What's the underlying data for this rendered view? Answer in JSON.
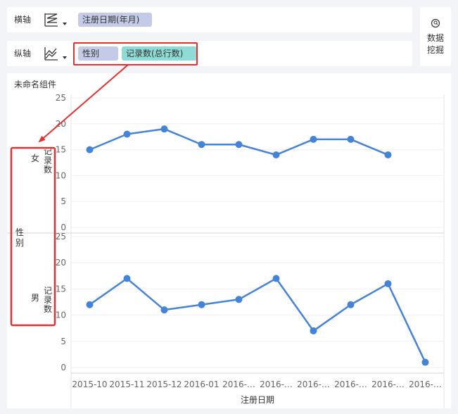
{
  "x_axis": {
    "label": "横轴",
    "fields": [
      "注册日期(年月)"
    ]
  },
  "y_axis": {
    "label": "纵轴",
    "fields": [
      "性别",
      "记录数(总行数)"
    ]
  },
  "mining_button": {
    "label": "数据\n挖掘"
  },
  "widget": {
    "title": "未命名组件"
  },
  "colors": {
    "line": "#4583d8",
    "highlight": "#e53030",
    "pill_blue": "#c4cbe8",
    "pill_teal": "#8fdcd6"
  },
  "chart_data": {
    "type": "line",
    "categories": [
      "2015-10",
      "2015-11",
      "2015-12",
      "2016-01",
      "2016-…",
      "2016-…",
      "2016-…",
      "2016-…",
      "2016-…",
      "2016-…"
    ],
    "xlabel": "注册日期",
    "row_dimension_label": "性别",
    "ylabel": "记录数",
    "ylim": [
      0,
      25
    ],
    "yticks": [
      0,
      5,
      10,
      15,
      20,
      25
    ],
    "series": [
      {
        "name": "女",
        "values": [
          15,
          18,
          19,
          16,
          16,
          14,
          17,
          17,
          14,
          null
        ]
      },
      {
        "name": "男",
        "values": [
          12,
          17,
          11,
          12,
          13,
          17,
          7,
          12,
          16,
          1
        ]
      }
    ]
  }
}
